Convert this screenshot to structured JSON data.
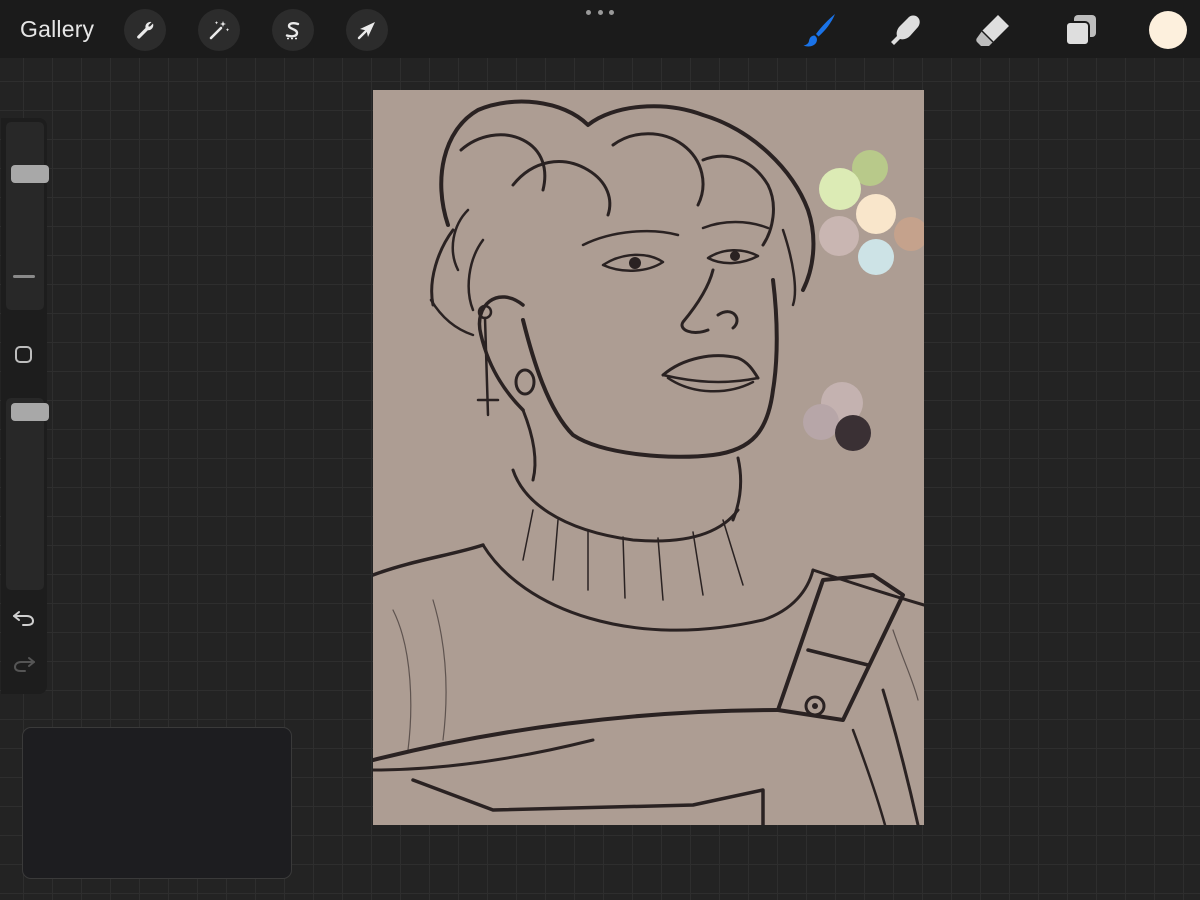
{
  "topbar": {
    "gallery_label": "Gallery",
    "left_tools": [
      {
        "name": "actions",
        "icon": "wrench-icon"
      },
      {
        "name": "adjustments",
        "icon": "magic-wand-icon"
      },
      {
        "name": "selection",
        "icon": "selection-s-icon"
      },
      {
        "name": "transform",
        "icon": "arrow-cursor-icon"
      }
    ],
    "more_menu_icon": "more-dots-icon",
    "right_tools": [
      {
        "name": "brush",
        "icon": "brush-icon",
        "active": true
      },
      {
        "name": "smudge",
        "icon": "smudge-finger-icon",
        "active": false
      },
      {
        "name": "eraser",
        "icon": "eraser-icon",
        "active": false
      },
      {
        "name": "layers",
        "icon": "layers-icon",
        "active": false
      }
    ],
    "current_color": "#fdf0dd",
    "active_tool_color": "#1a73e8"
  },
  "sidebar": {
    "brush_size_level": 0.75,
    "opacity_level": 0.97,
    "modify_button_icon": "square-icon",
    "undo_icon": "undo-icon",
    "redo_icon": "redo-icon"
  },
  "canvas": {
    "background_color": "#ad9d93",
    "palette_swatches": [
      "#b8c98a",
      "#dcebb5",
      "#f9e6cb",
      "#c9b6b2",
      "#c5a28c",
      "#cde3e6",
      "#c4b2b0",
      "#b7a6a8",
      "#3a3034"
    ]
  }
}
